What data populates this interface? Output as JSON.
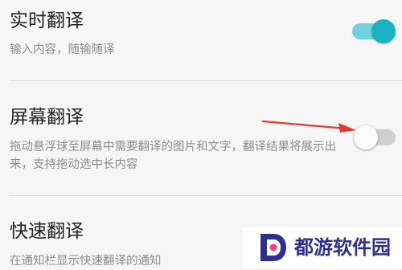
{
  "settings": [
    {
      "title": "实时翻译",
      "description": "输入内容，随输随译",
      "enabled": true
    },
    {
      "title": "屏幕翻译",
      "description": "拖动悬浮球至屏幕中需要翻译的图片和文字，翻译结果将展示出来，支持拖动选中长内容",
      "enabled": false
    },
    {
      "title": "快速翻译",
      "description": "在通知栏显示快速翻译的通知"
    }
  ],
  "colors": {
    "toggle_on": "#1bb3c4",
    "toggle_on_track": "#6fd3de",
    "toggle_off_track": "#cfcfcf",
    "annotation_arrow": "#e53935",
    "watermark_text": "#2e2f8f"
  },
  "watermark": {
    "text": "都游软件园",
    "logo_icon": "d-letter-logo"
  }
}
